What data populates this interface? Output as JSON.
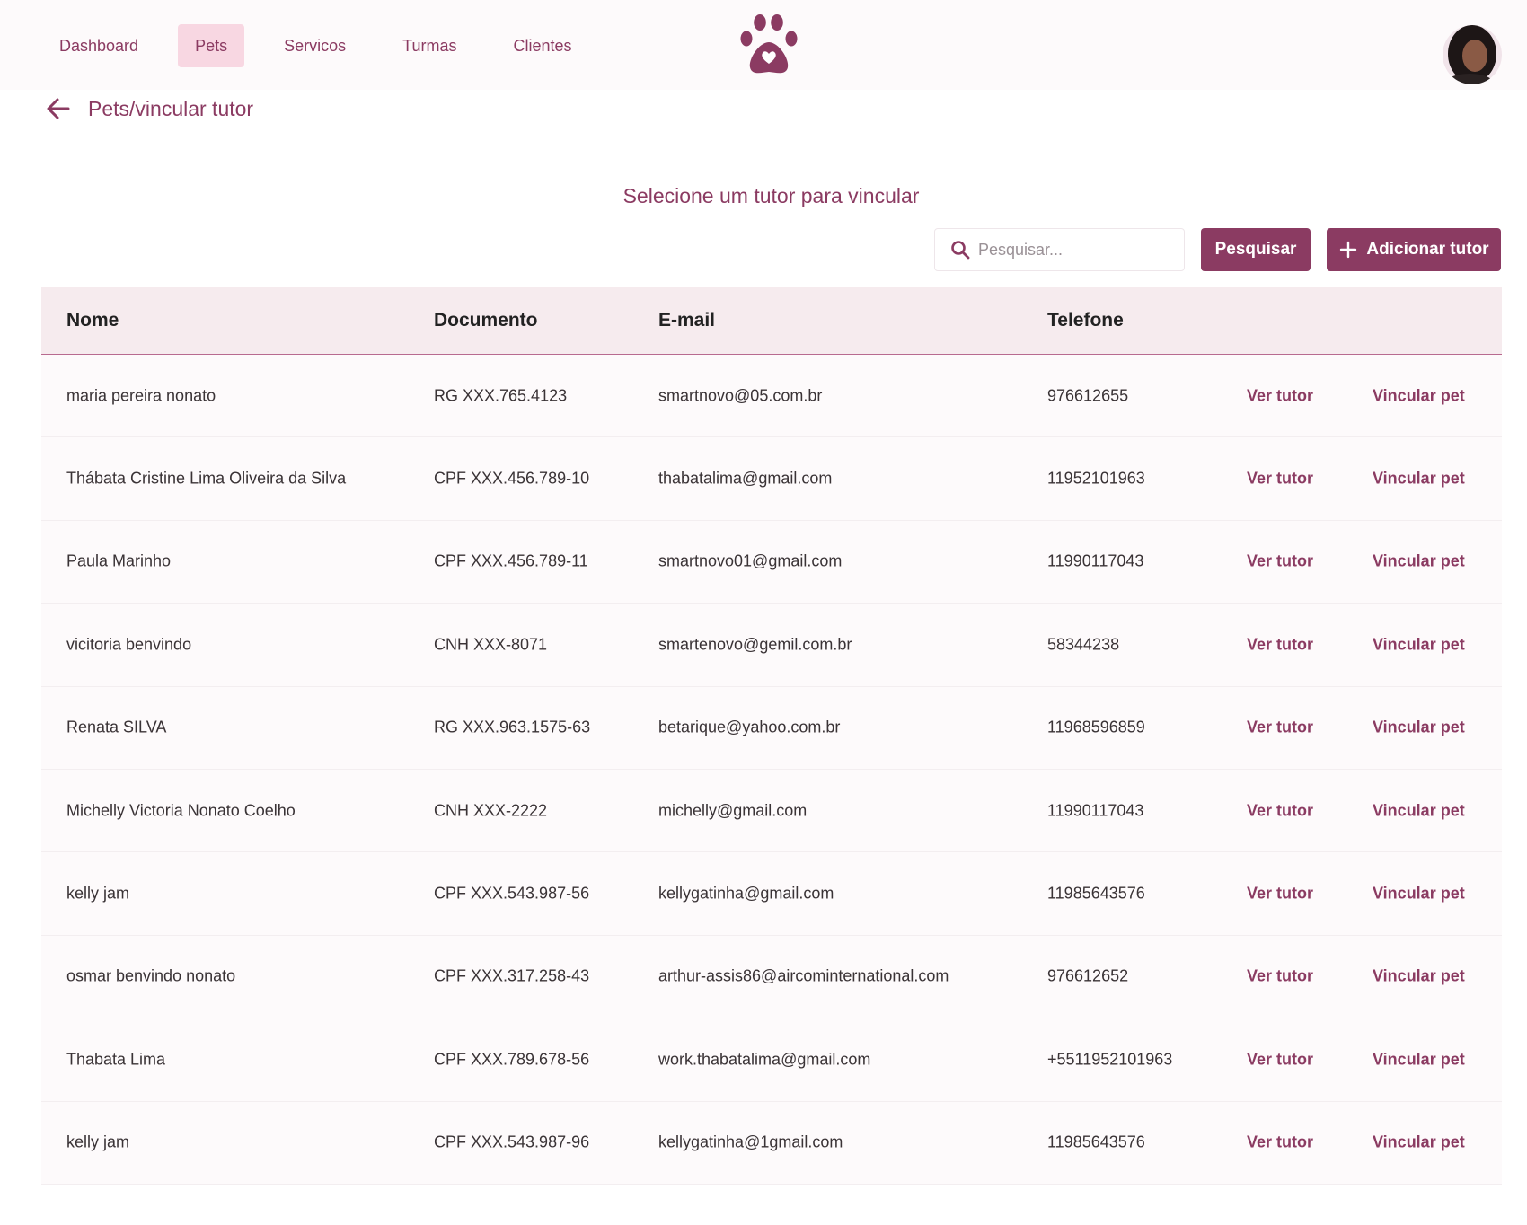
{
  "nav": {
    "items": [
      {
        "label": "Dashboard",
        "name": "dashboard",
        "active": false
      },
      {
        "label": "Pets",
        "name": "pets",
        "active": true
      },
      {
        "label": "Servicos",
        "name": "servicos",
        "active": false
      },
      {
        "label": "Turmas",
        "name": "turmas",
        "active": false
      },
      {
        "label": "Clientes",
        "name": "clientes",
        "active": false
      }
    ]
  },
  "breadcrumb": {
    "text": "Pets/vincular tutor",
    "icon": "arrow-left-icon"
  },
  "page": {
    "title": "Selecione um tutor para vincular"
  },
  "search": {
    "placeholder": "Pesquisar...",
    "value": "",
    "button_label": "Pesquisar"
  },
  "add_button": {
    "label": "Adicionar tutor",
    "icon": "plus-icon"
  },
  "table": {
    "columns": [
      "Nome",
      "Documento",
      "E-mail",
      "Telefone"
    ],
    "action_labels": {
      "view": "Ver tutor",
      "link": "Vincular pet"
    },
    "rows": [
      {
        "nome": "maria pereira nonato",
        "documento": "RG XXX.765.4123",
        "email": "smartnovo@05.com.br",
        "telefone": "976612655"
      },
      {
        "nome": "Thábata Cristine Lima Oliveira da Silva",
        "documento": "CPF XXX.456.789-10",
        "email": "thabatalima@gmail.com",
        "telefone": "11952101963"
      },
      {
        "nome": "Paula Marinho",
        "documento": "CPF XXX.456.789-11",
        "email": "smartnovo01@gmail.com",
        "telefone": "11990117043"
      },
      {
        "nome": "vicitoria benvindo",
        "documento": "CNH XXX-8071",
        "email": "smartenovo@gemil.com.br",
        "telefone": "58344238"
      },
      {
        "nome": "Renata SILVA",
        "documento": "RG XXX.963.1575-63",
        "email": "betarique@yahoo.com.br",
        "telefone": "11968596859"
      },
      {
        "nome": "Michelly Victoria Nonato Coelho",
        "documento": "CNH XXX-2222",
        "email": "michelly@gmail.com",
        "telefone": "11990117043"
      },
      {
        "nome": "kelly jam",
        "documento": "CPF XXX.543.987-56",
        "email": "kellygatinha@gmail.com",
        "telefone": "11985643576"
      },
      {
        "nome": "osmar benvindo nonato",
        "documento": "CPF XXX.317.258-43",
        "email": "arthur-assis86@aircominternational.com",
        "telefone": "976612652"
      },
      {
        "nome": "Thabata Lima",
        "documento": "CPF XXX.789.678-56",
        "email": "work.thabatalima@gmail.com",
        "telefone": "+5511952101963"
      },
      {
        "nome": "kelly jam",
        "documento": "CPF XXX.543.987-96",
        "email": "kellygatinha@1gmail.com",
        "telefone": "11985643576"
      }
    ]
  },
  "colors": {
    "accent": "#8b3b62",
    "nav_active_bg": "#f8d7e2",
    "header_bg": "#f6ebee",
    "row_bg": "#fdfafb"
  }
}
